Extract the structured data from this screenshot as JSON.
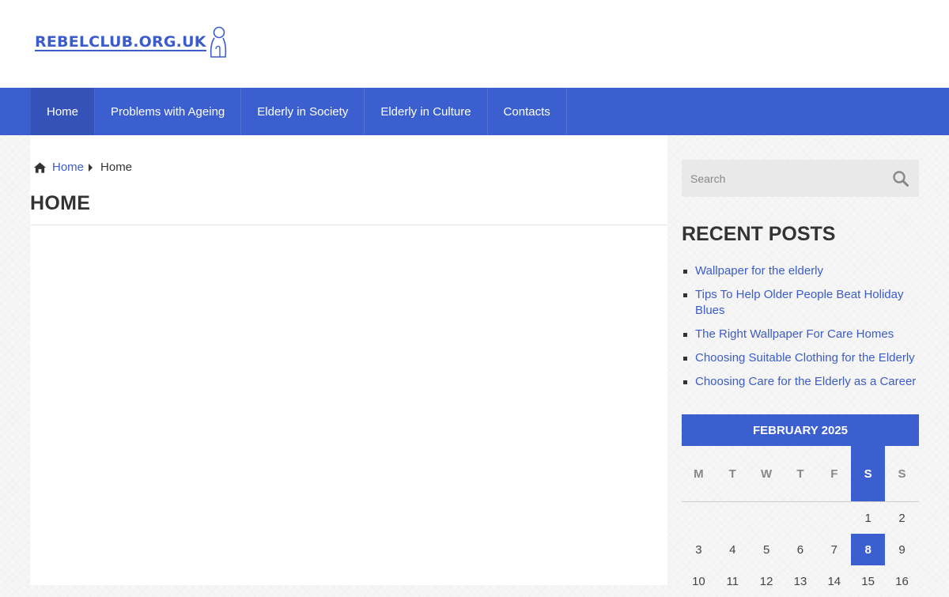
{
  "header": {
    "logo_text": "REBELCLUB.ORG.UK"
  },
  "nav": {
    "items": [
      {
        "label": "Home"
      },
      {
        "label": "Problems with Ageing"
      },
      {
        "label": "Elderly in Society"
      },
      {
        "label": "Elderly in Culture"
      },
      {
        "label": "Contacts"
      }
    ]
  },
  "breadcrumb": {
    "link": "Home",
    "current": "Home"
  },
  "main": {
    "title": "HOME"
  },
  "search": {
    "placeholder": "Search"
  },
  "recent_posts": {
    "title": "RECENT POSTS",
    "items": [
      {
        "label": "Wallpaper for the elderly"
      },
      {
        "label": "Tips To Help Older People Beat Holiday Blues"
      },
      {
        "label": "The Right Wallpaper For Care Homes"
      },
      {
        "label": "Choosing Suitable Clothing for the Elderly"
      },
      {
        "label": "Choosing Care for the Elderly as a Career"
      }
    ]
  },
  "calendar": {
    "month": "FEBRUARY 2025",
    "weekdays": [
      "M",
      "T",
      "W",
      "T",
      "F",
      "S",
      "S"
    ],
    "highlight_weekday_index": 5,
    "today": "8",
    "weeks": [
      [
        "",
        "",
        "",
        "",
        "",
        "1",
        "2"
      ],
      [
        "3",
        "4",
        "5",
        "6",
        "7",
        "8",
        "9"
      ],
      [
        "10",
        "11",
        "12",
        "13",
        "14",
        "15",
        "16"
      ]
    ]
  },
  "colors": {
    "brand_blue": "#3b5fcf",
    "link_blue": "#3b5cc9"
  }
}
